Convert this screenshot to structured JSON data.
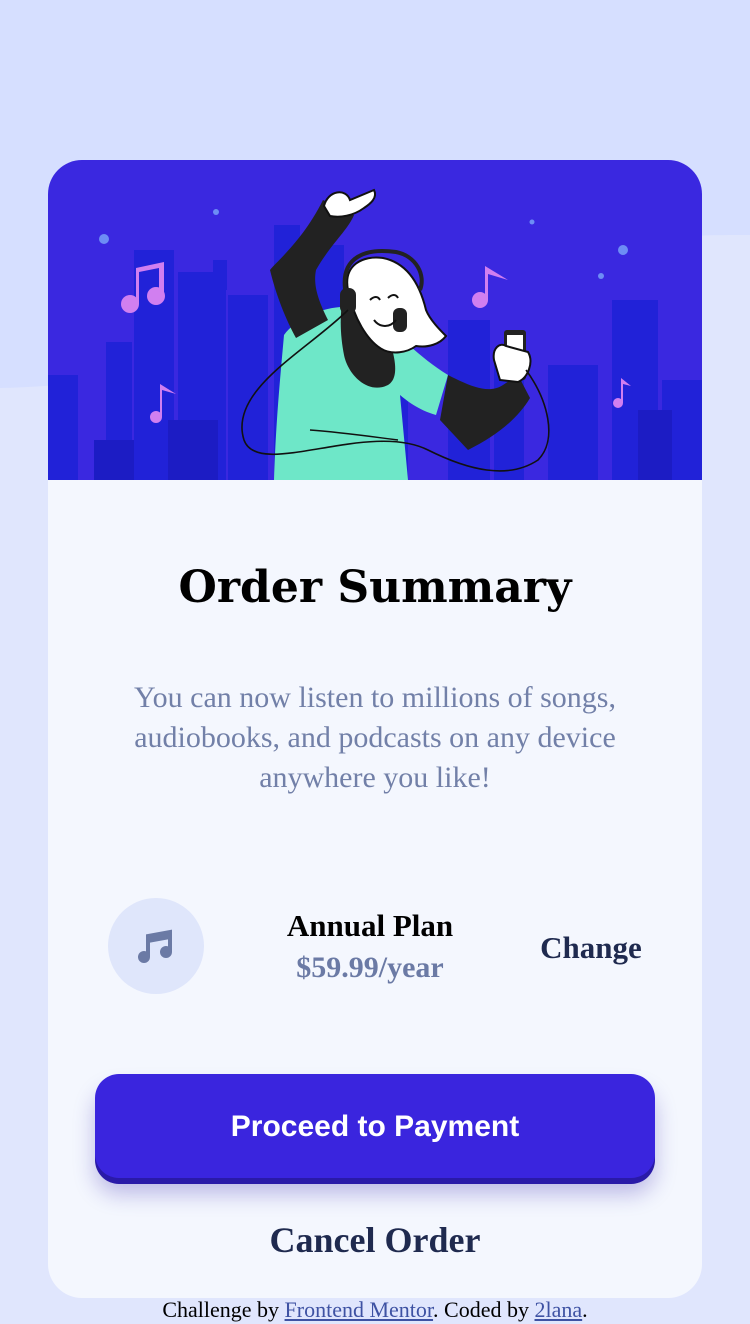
{
  "card": {
    "title": "Order Summary",
    "description": "You can now listen to millions of songs, audiobooks, and podcasts on any device anywhere you like!",
    "hero_image": "illustration-hero",
    "plan": {
      "icon": "music-icon",
      "name": "Annual Plan",
      "price": "$59.99/year",
      "change_label": "Change"
    },
    "proceed_label": "Proceed to Payment",
    "cancel_label": "Cancel Order"
  },
  "attribution": {
    "prefix": "Challenge by ",
    "link1": "Frontend Mentor",
    "middle": ". Coded by ",
    "link2": "2lana",
    "suffix": "."
  },
  "colors": {
    "page_background": "#e0e6fd",
    "hero_background": "#3a28e0",
    "card_background": "#f4f7fe",
    "primary_button": "#3a25de",
    "text_dark": "#1f2a4f",
    "text_muted": "#7280a8"
  }
}
